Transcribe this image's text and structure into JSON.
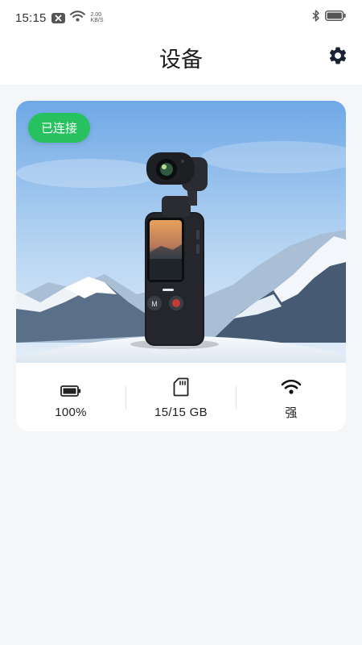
{
  "status_bar": {
    "time": "15:15",
    "net_speed_value": "2.00",
    "net_speed_unit": "KB/S"
  },
  "header": {
    "title": "设备"
  },
  "device": {
    "connection_badge": "已连接",
    "stats": {
      "battery": "100%",
      "storage": "15/15 GB",
      "signal": "强"
    }
  },
  "icons": {
    "settings": "gear-icon",
    "battery": "battery-icon",
    "storage": "sd-card-icon",
    "signal": "wifi-icon"
  },
  "colors": {
    "accent_green": "#27c15f",
    "background": "#f5f6f8",
    "card": "#ffffff"
  }
}
